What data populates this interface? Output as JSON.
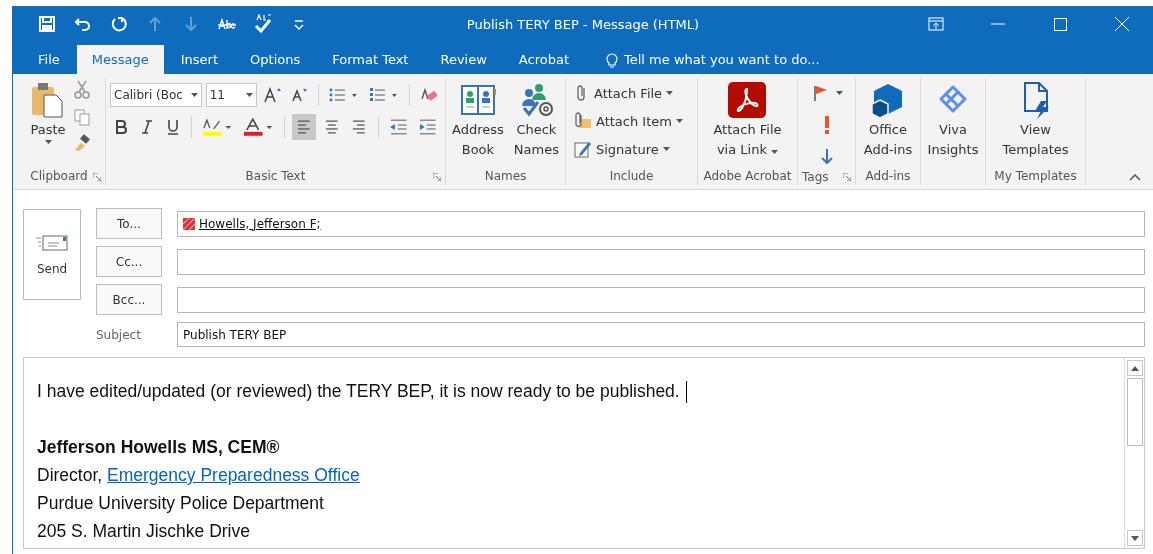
{
  "title_bar": {
    "title": "Publish TERY BEP - Message (HTML)",
    "quick_access": [
      {
        "kind": "save",
        "disabled": false
      },
      {
        "kind": "undo",
        "disabled": false
      },
      {
        "kind": "redo",
        "disabled": false
      },
      {
        "kind": "up",
        "disabled": true
      },
      {
        "kind": "down",
        "disabled": true
      },
      {
        "kind": "strike",
        "disabled": false
      },
      {
        "kind": "spell",
        "disabled": false
      },
      {
        "kind": "customize",
        "disabled": false
      }
    ]
  },
  "tabs": [
    {
      "label": "File",
      "selected": false
    },
    {
      "label": "Message",
      "selected": true
    },
    {
      "label": "Insert",
      "selected": false
    },
    {
      "label": "Options",
      "selected": false
    },
    {
      "label": "Format Text",
      "selected": false
    },
    {
      "label": "Review",
      "selected": false
    },
    {
      "label": "Acrobat",
      "selected": false
    }
  ],
  "tell_me": {
    "placeholder": "Tell me what you want to do..."
  },
  "ribbon": {
    "groups": [
      {
        "kind": "clipboard",
        "label": "Clipboard",
        "launcher": true,
        "paste": "Paste"
      },
      {
        "kind": "basic_text",
        "label": "Basic Text",
        "launcher": true,
        "font": "Calibri (Boc",
        "size": "11",
        "alignment": [
          {
            "kind": "left",
            "selected": true
          },
          {
            "kind": "center",
            "selected": false
          },
          {
            "kind": "right",
            "selected": false
          }
        ]
      },
      {
        "kind": "large",
        "label": "Names",
        "launcher": false,
        "buttons": [
          {
            "lines": [
              "Address",
              "Book"
            ]
          },
          {
            "lines": [
              "Check",
              "Names"
            ]
          }
        ]
      },
      {
        "kind": "small",
        "label": "Include",
        "launcher": false,
        "buttons": [
          {
            "text": "Attach File"
          },
          {
            "text": "Attach Item"
          },
          {
            "text": "Signature"
          }
        ]
      },
      {
        "kind": "large",
        "label": "Adobe Acrobat",
        "launcher": false,
        "buttons": [
          {
            "lines": [
              "Attach File",
              "via Link"
            ],
            "dropdown": true
          }
        ]
      },
      {
        "kind": "tags",
        "label": "Tags",
        "launcher": true
      },
      {
        "kind": "large",
        "label": "Add-ins",
        "launcher": false,
        "buttons": [
          {
            "lines": [
              "Office",
              "Add-ins"
            ]
          }
        ]
      },
      {
        "kind": "large",
        "launcher": false,
        "buttons": [
          {
            "lines": [
              "Viva",
              "Insights"
            ]
          }
        ]
      },
      {
        "kind": "large",
        "label": "My Templates",
        "launcher": false,
        "buttons": [
          {
            "lines": [
              "View",
              "Templates"
            ]
          }
        ]
      }
    ]
  },
  "compose": {
    "send": "Send",
    "recipients": [
      {
        "button": "To...",
        "value": "Howells, Jefferson F;"
      },
      {
        "button": "Cc..."
      },
      {
        "button": "Bcc..."
      }
    ],
    "subject": {
      "label": "Subject",
      "value": "Publish TERY BEP"
    },
    "body": [
      {
        "kind": "text",
        "text": "I have edited/updated (or reviewed) the TERY BEP, it is now ready to be published."
      },
      {
        "kind": "blank"
      },
      {
        "kind": "bold",
        "text": "Jefferson Howells MS, CEM®"
      },
      {
        "kind": "link",
        "text": "Director, ",
        "link": "Emergency Preparedness Office"
      },
      {
        "kind": "text",
        "text": "Purdue University Police Department"
      },
      {
        "kind": "text",
        "text": "205 S. Martin Jischke Drive"
      }
    ]
  }
}
